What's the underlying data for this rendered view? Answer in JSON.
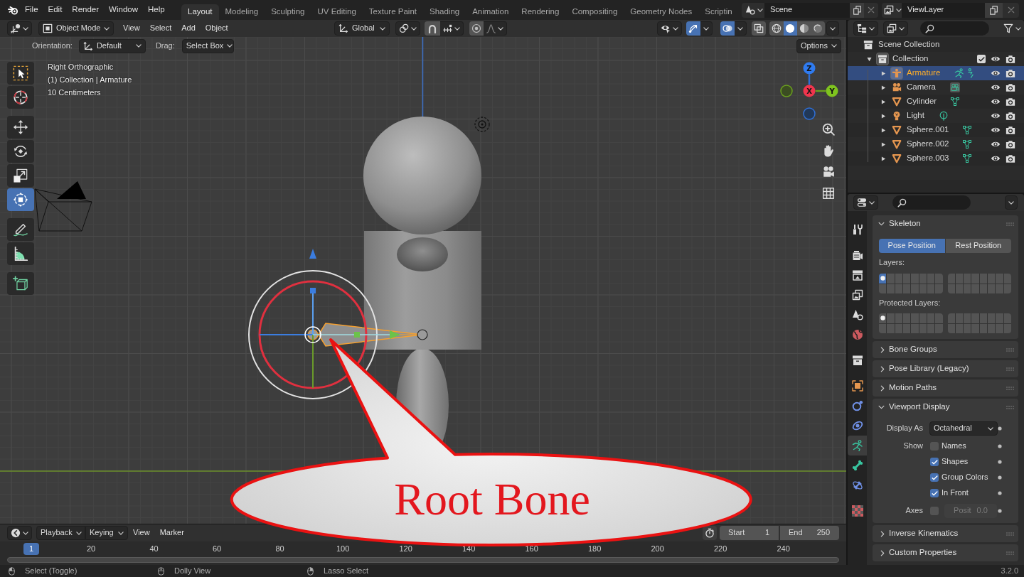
{
  "top_bar": {
    "menus": [
      "File",
      "Edit",
      "Render",
      "Window",
      "Help"
    ],
    "workspaces": [
      {
        "label": "Layout",
        "selected": true
      },
      {
        "label": "Modeling",
        "selected": false
      },
      {
        "label": "Sculpting",
        "selected": false
      },
      {
        "label": "UV Editing",
        "selected": false
      },
      {
        "label": "Texture Paint",
        "selected": false
      },
      {
        "label": "Shading",
        "selected": false
      },
      {
        "label": "Animation",
        "selected": false
      },
      {
        "label": "Rendering",
        "selected": false
      },
      {
        "label": "Compositing",
        "selected": false
      },
      {
        "label": "Geometry Nodes",
        "selected": false
      },
      {
        "label": "Scriptin",
        "selected": false
      }
    ],
    "scene": "Scene",
    "view_layer": "ViewLayer"
  },
  "viewport_header": {
    "mode": "Object Mode",
    "menus": [
      "View",
      "Select",
      "Add",
      "Object"
    ],
    "orientation": "Global",
    "snap": {
      "on": false
    },
    "proportional_editing": {
      "on": false
    },
    "gizmos": {
      "on": true
    },
    "overlays": {
      "on": true
    },
    "xray": {
      "on": false
    },
    "shading": [
      {
        "kind": "wireframe",
        "selected": false
      },
      {
        "kind": "solid",
        "selected": true
      },
      {
        "kind": "material",
        "selected": false
      },
      {
        "kind": "rendered",
        "selected": false
      }
    ]
  },
  "tool_settings": {
    "orientation_label": "Orientation:",
    "orientation": "Default",
    "drag_label": "Drag:",
    "drag": "Select Box",
    "options": "Options"
  },
  "toolbar": {
    "groups": [
      {
        "tools": [
          {
            "kind": "select_box",
            "selected": false
          },
          {
            "kind": "cursor",
            "selected": false
          }
        ]
      },
      {
        "tools": [
          {
            "kind": "move",
            "selected": false
          },
          {
            "kind": "rotate",
            "selected": false
          },
          {
            "kind": "scale",
            "selected": false
          },
          {
            "kind": "transform",
            "selected": true
          }
        ]
      },
      {
        "tools": [
          {
            "kind": "annotate",
            "selected": false
          },
          {
            "kind": "measure",
            "selected": false
          }
        ]
      },
      {
        "tools": [
          {
            "kind": "add_cube",
            "selected": false
          }
        ]
      }
    ]
  },
  "viewport": {
    "info": [
      "Right Orthographic",
      "(1) Collection | Armature",
      "10 Centimeters"
    ],
    "navigation_gizmo": {
      "z": "Z",
      "x": "X",
      "y": "Y"
    }
  },
  "outliner": {
    "tree": [
      {
        "label": "Scene Collection",
        "kind": "scene_collection",
        "selected": false,
        "active": false,
        "children": [
          {
            "label": "Collection",
            "kind": "collection",
            "selected": false,
            "active": true,
            "expanded": true,
            "checked": true,
            "visible": true,
            "children": [
              {
                "label": "Armature",
                "kind": "armature",
                "selected": true,
                "active": true,
                "expanded": false,
                "visible": true
              },
              {
                "label": "Camera",
                "kind": "camera",
                "selected": false,
                "active": false,
                "expanded": false,
                "visible": true
              },
              {
                "label": "Cylinder",
                "kind": "mesh",
                "selected": false,
                "active": false,
                "expanded": false,
                "visible": true
              },
              {
                "label": "Light",
                "kind": "light",
                "selected": false,
                "active": false,
                "expanded": false,
                "visible": true
              },
              {
                "label": "Sphere.001",
                "kind": "mesh",
                "selected": false,
                "active": false,
                "expanded": false,
                "visible": true
              },
              {
                "label": "Sphere.002",
                "kind": "mesh",
                "selected": false,
                "active": false,
                "expanded": false,
                "visible": true
              },
              {
                "label": "Sphere.003",
                "kind": "mesh",
                "selected": false,
                "active": false,
                "expanded": false,
                "visible": true
              }
            ]
          }
        ]
      }
    ]
  },
  "properties": {
    "tab_groups": [
      {
        "tabs": [
          {
            "kind": "tool",
            "selected": false
          }
        ]
      },
      {
        "tabs": [
          {
            "kind": "render",
            "selected": false
          },
          {
            "kind": "output",
            "selected": false
          },
          {
            "kind": "view_layer",
            "selected": false
          },
          {
            "kind": "scene",
            "selected": false
          },
          {
            "kind": "world",
            "selected": false
          }
        ]
      },
      {
        "tabs": [
          {
            "kind": "collection",
            "selected": false
          }
        ]
      },
      {
        "tabs": [
          {
            "kind": "object",
            "selected": false
          },
          {
            "kind": "physics",
            "selected": false
          },
          {
            "kind": "object_constraints",
            "selected": false
          },
          {
            "kind": "armature_data",
            "selected": true
          },
          {
            "kind": "bone",
            "selected": false
          },
          {
            "kind": "bone_constraints",
            "selected": false
          }
        ]
      },
      {
        "tabs": [
          {
            "kind": "texture",
            "selected": false
          }
        ]
      }
    ],
    "panels": [
      {
        "kind": "skeleton",
        "title": "Skeleton",
        "expanded": true,
        "positions": [
          {
            "label": "Pose Position",
            "selected": true
          },
          {
            "label": "Rest Position",
            "selected": false
          }
        ],
        "layers_label": "Layers:",
        "layers": [
          {
            "selected": true,
            "occupied": true
          },
          {
            "selected": false,
            "occupied": false
          },
          {
            "selected": false,
            "occupied": false
          },
          {
            "selected": false,
            "occupied": false
          },
          {
            "selected": false,
            "occupied": false
          },
          {
            "selected": false,
            "occupied": false
          },
          {
            "selected": false,
            "occupied": false
          },
          {
            "selected": false,
            "occupied": false
          },
          {
            "selected": false,
            "occupied": false
          },
          {
            "selected": false,
            "occupied": false
          },
          {
            "selected": false,
            "occupied": false
          },
          {
            "selected": false,
            "occupied": false
          },
          {
            "selected": false,
            "occupied": false
          },
          {
            "selected": false,
            "occupied": false
          },
          {
            "selected": false,
            "occupied": false
          },
          {
            "selected": false,
            "occupied": false
          },
          {
            "selected": false,
            "occupied": false
          },
          {
            "selected": false,
            "occupied": false
          },
          {
            "selected": false,
            "occupied": false
          },
          {
            "selected": false,
            "occupied": false
          },
          {
            "selected": false,
            "occupied": false
          },
          {
            "selected": false,
            "occupied": false
          },
          {
            "selected": false,
            "occupied": false
          },
          {
            "selected": false,
            "occupied": false
          },
          {
            "selected": false,
            "occupied": false
          },
          {
            "selected": false,
            "occupied": false
          },
          {
            "selected": false,
            "occupied": false
          },
          {
            "selected": false,
            "occupied": false
          },
          {
            "selected": false,
            "occupied": false
          },
          {
            "selected": false,
            "occupied": false
          },
          {
            "selected": false,
            "occupied": false
          },
          {
            "selected": false,
            "occupied": false
          }
        ],
        "protected_label": "Protected Layers:",
        "protected_layers": [
          {
            "selected": false,
            "occupied": true
          },
          {
            "selected": false,
            "occupied": false
          },
          {
            "selected": false,
            "occupied": false
          },
          {
            "selected": false,
            "occupied": false
          },
          {
            "selected": false,
            "occupied": false
          },
          {
            "selected": false,
            "occupied": false
          },
          {
            "selected": false,
            "occupied": false
          },
          {
            "selected": false,
            "occupied": false
          },
          {
            "selected": false,
            "occupied": false
          },
          {
            "selected": false,
            "occupied": false
          },
          {
            "selected": false,
            "occupied": false
          },
          {
            "selected": false,
            "occupied": false
          },
          {
            "selected": false,
            "occupied": false
          },
          {
            "selected": false,
            "occupied": false
          },
          {
            "selected": false,
            "occupied": false
          },
          {
            "selected": false,
            "occupied": false
          },
          {
            "selected": false,
            "occupied": false
          },
          {
            "selected": false,
            "occupied": false
          },
          {
            "selected": false,
            "occupied": false
          },
          {
            "selected": false,
            "occupied": false
          },
          {
            "selected": false,
            "occupied": false
          },
          {
            "selected": false,
            "occupied": false
          },
          {
            "selected": false,
            "occupied": false
          },
          {
            "selected": false,
            "occupied": false
          },
          {
            "selected": false,
            "occupied": false
          },
          {
            "selected": false,
            "occupied": false
          },
          {
            "selected": false,
            "occupied": false
          },
          {
            "selected": false,
            "occupied": false
          },
          {
            "selected": false,
            "occupied": false
          },
          {
            "selected": false,
            "occupied": false
          },
          {
            "selected": false,
            "occupied": false
          },
          {
            "selected": false,
            "occupied": false
          }
        ]
      },
      {
        "kind": "section",
        "title": "Bone Groups",
        "expanded": false
      },
      {
        "kind": "section",
        "title": "Pose Library (Legacy)",
        "expanded": false
      },
      {
        "kind": "section",
        "title": "Motion Paths",
        "expanded": false
      },
      {
        "kind": "viewport_display",
        "title": "Viewport Display",
        "expanded": true,
        "display_as": {
          "label": "Display As",
          "value": "Octahedral"
        },
        "show_label": "Show",
        "show": [
          {
            "label": "Names",
            "checked": false
          },
          {
            "label": "Shapes",
            "checked": true
          },
          {
            "label": "Group Colors",
            "checked": true
          },
          {
            "label": "In Front",
            "checked": true
          }
        ],
        "axes": {
          "label": "Axes",
          "checked": false,
          "position_label": "Posit",
          "position_value": "0.0",
          "disabled": true
        }
      },
      {
        "kind": "section",
        "title": "Inverse Kinematics",
        "expanded": false
      },
      {
        "kind": "section",
        "title": "Custom Properties",
        "expanded": false
      }
    ]
  },
  "callout": {
    "text": "Root Bone"
  },
  "timeline": {
    "dropdowns": [
      "Playback",
      "Keying"
    ],
    "menus": [
      "View",
      "Marker"
    ],
    "start": {
      "label": "Start",
      "value": "1"
    },
    "end": {
      "label": "End",
      "value": "250"
    },
    "current_frame": "1",
    "frame_labels": [
      "20",
      "40",
      "60",
      "80",
      "100",
      "120",
      "140",
      "160",
      "180",
      "200",
      "220",
      "240"
    ]
  },
  "status_bar": {
    "hints": [
      {
        "kind": "left_click",
        "label": "Select (Toggle)"
      },
      {
        "kind": "middle_click",
        "label": "Dolly View"
      },
      {
        "kind": "right_click",
        "label": "Lasso Select"
      }
    ],
    "version": "3.2.0"
  }
}
